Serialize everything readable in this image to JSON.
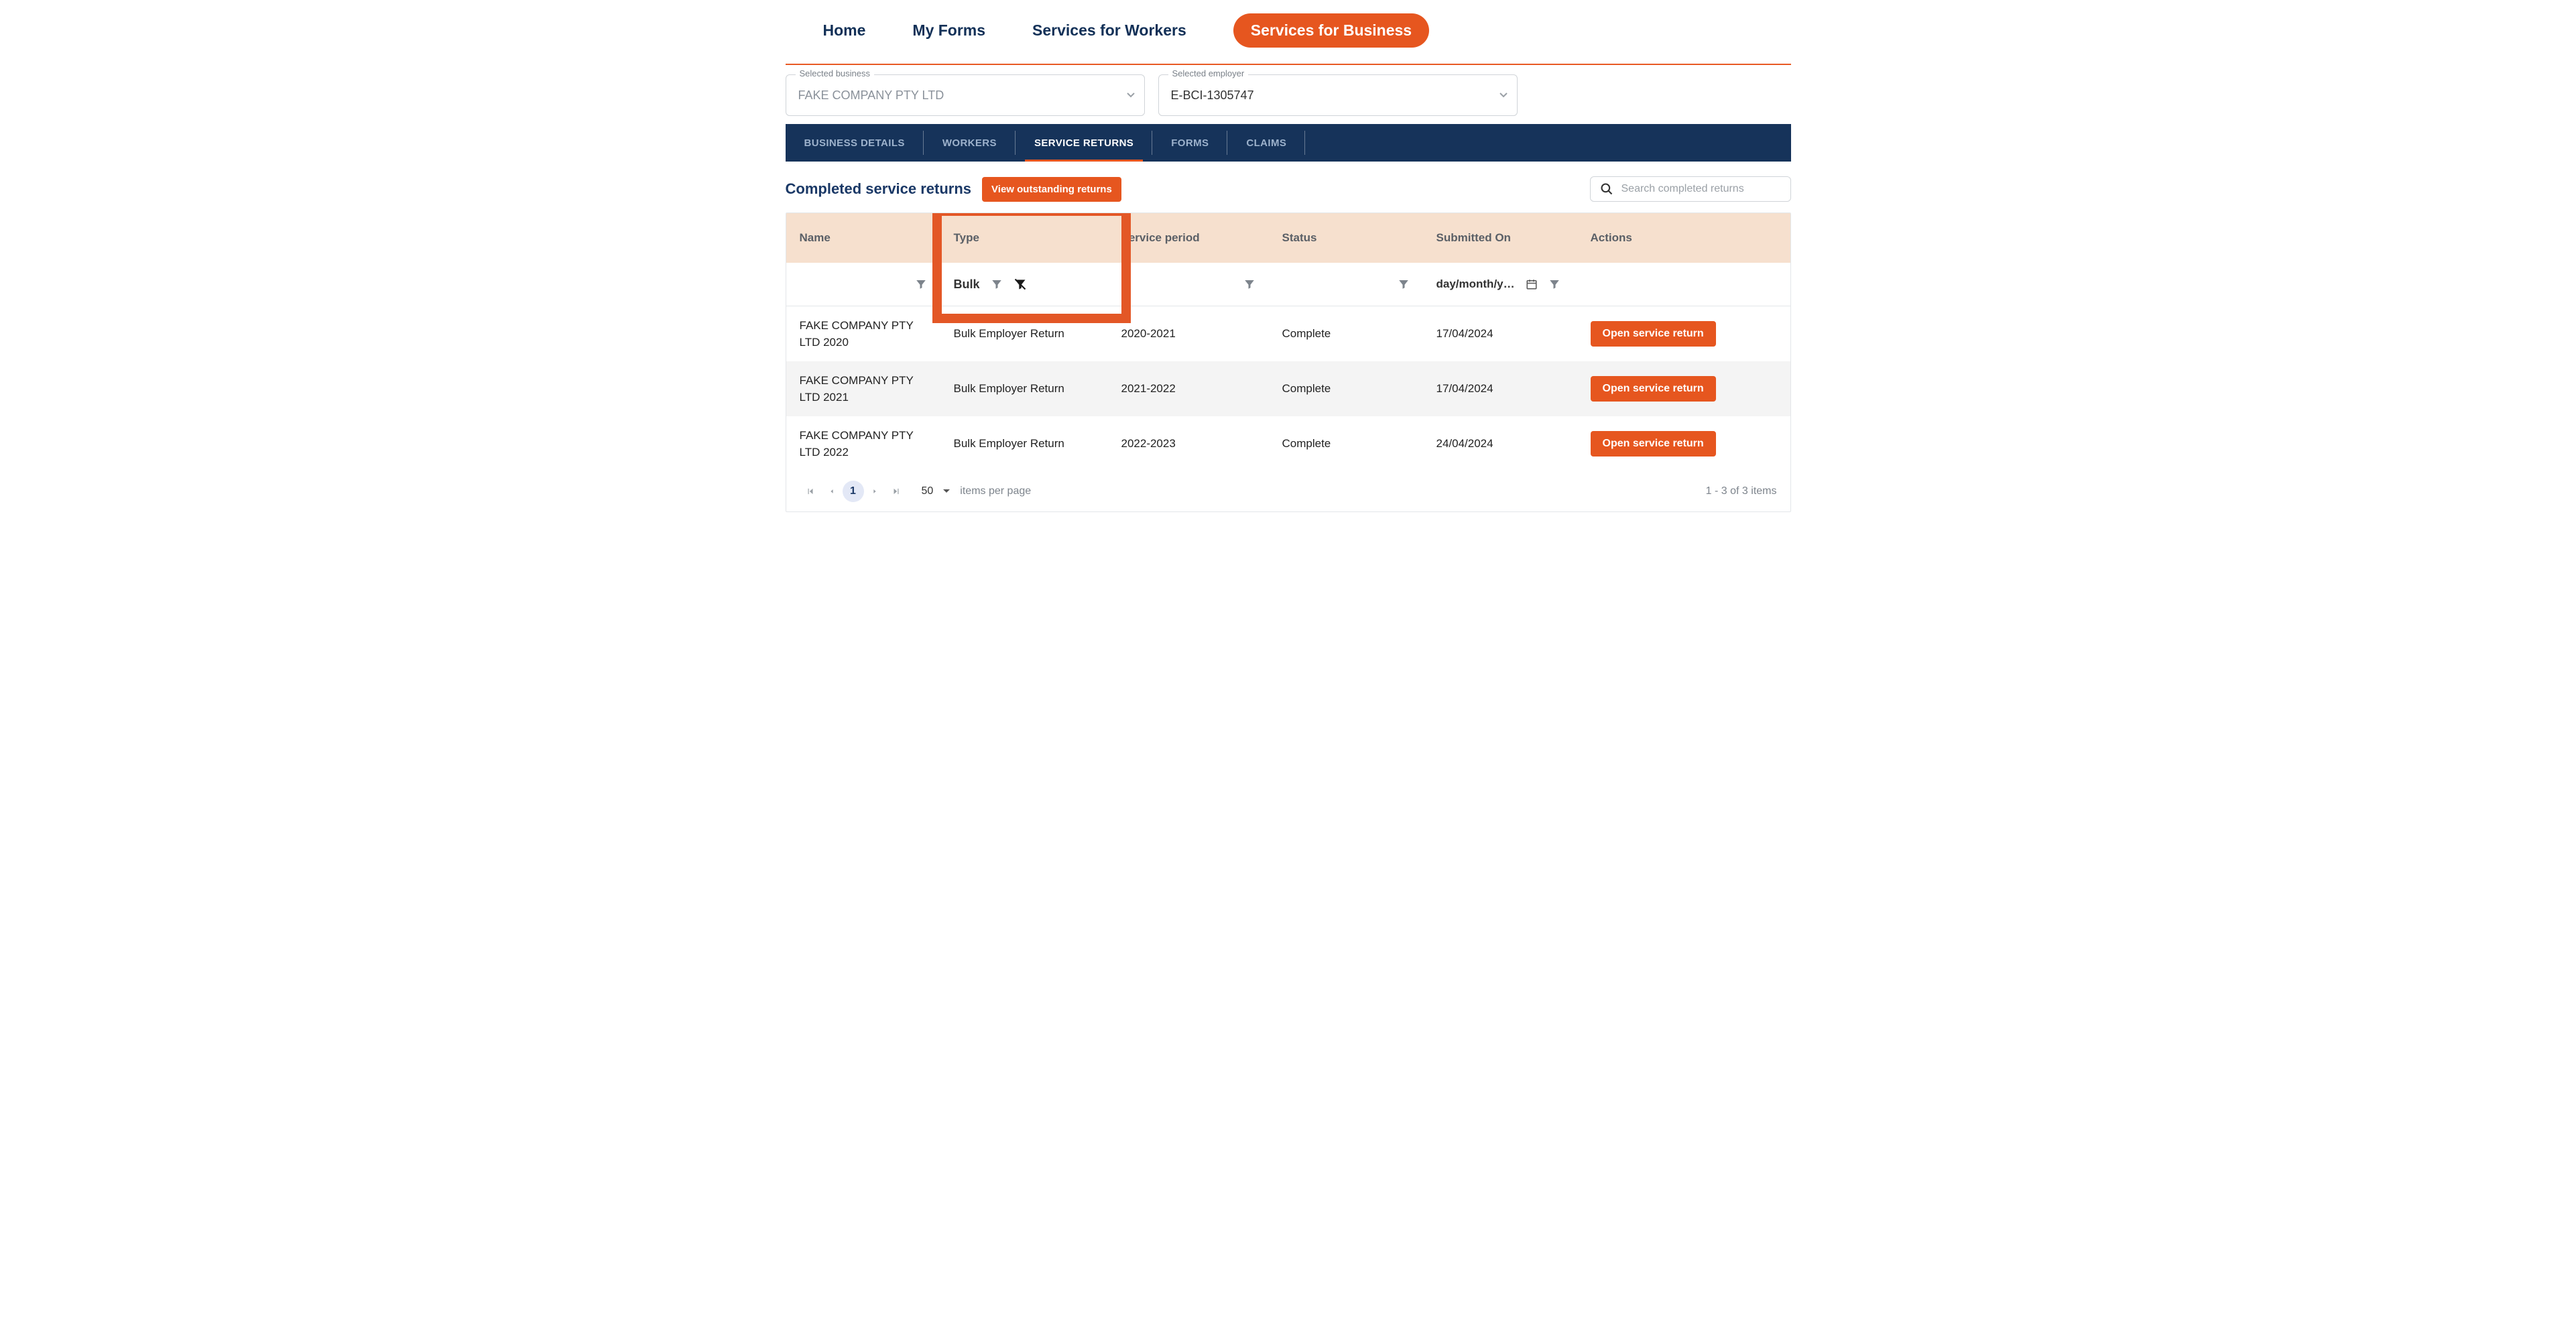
{
  "topnav": {
    "items": [
      {
        "label": "Home"
      },
      {
        "label": "My Forms"
      },
      {
        "label": "Services for Workers"
      },
      {
        "label": "Services for Business"
      }
    ],
    "active_index": 3
  },
  "selectors": {
    "business": {
      "label": "Selected business",
      "value": "FAKE COMPANY PTY LTD"
    },
    "employer": {
      "label": "Selected employer",
      "value": "E-BCI-1305747"
    }
  },
  "section_tabs": {
    "items": [
      {
        "label": "BUSINESS DETAILS"
      },
      {
        "label": "WORKERS"
      },
      {
        "label": "SERVICE RETURNS"
      },
      {
        "label": "FORMS"
      },
      {
        "label": "CLAIMS"
      }
    ],
    "active_index": 2
  },
  "page": {
    "title": "Completed service returns",
    "view_outstanding_label": "View outstanding returns",
    "search_placeholder": "Search completed returns"
  },
  "table": {
    "columns": {
      "name": "Name",
      "type": "Type",
      "period": "Service period",
      "status": "Status",
      "submitted": "Submitted On",
      "actions": "Actions"
    },
    "filters": {
      "type_value": "Bulk",
      "date_placeholder": "day/month/y…"
    },
    "rows": [
      {
        "name": "FAKE COMPANY PTY LTD 2020",
        "type": "Bulk Employer Return",
        "period": "2020-2021",
        "status": "Complete",
        "submitted": "17/04/2024"
      },
      {
        "name": "FAKE COMPANY PTY LTD 2021",
        "type": "Bulk Employer Return",
        "period": "2021-2022",
        "status": "Complete",
        "submitted": "17/04/2024"
      },
      {
        "name": "FAKE COMPANY PTY LTD 2022",
        "type": "Bulk Employer Return",
        "period": "2022-2023",
        "status": "Complete",
        "submitted": "24/04/2024"
      }
    ],
    "open_label": "Open service return"
  },
  "pager": {
    "page": "1",
    "page_size": "50",
    "per_page_label": "items per page",
    "count_label": "1 - 3 of 3 items"
  }
}
